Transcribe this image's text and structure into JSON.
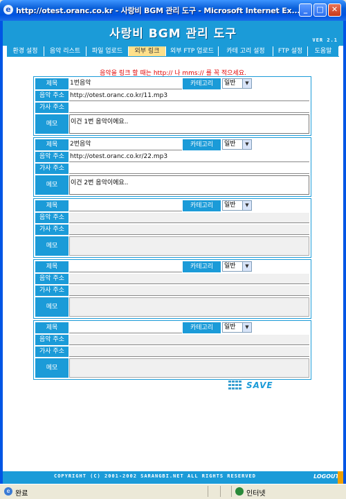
{
  "window": {
    "title": "http://otest.oranc.co.kr - 사랑비 BGM 관리 도구 - Microsoft Internet Ex...",
    "minimize": "_",
    "maximize": "□",
    "close": "✕"
  },
  "header": {
    "logo": "사랑비 BGM 관리 도구",
    "version": "VER 2.1"
  },
  "nav": [
    {
      "label": "환경 설정",
      "active": false
    },
    {
      "label": "음악 리스트",
      "active": false
    },
    {
      "label": "파일 업로드",
      "active": false
    },
    {
      "label": "외부 링크",
      "active": true
    },
    {
      "label": "외부 FTP 업로드",
      "active": false
    },
    {
      "label": "카테 고리 설정",
      "active": false
    },
    {
      "label": "FTP 설정",
      "active": false
    },
    {
      "label": "도움말",
      "active": false
    }
  ],
  "notice": "음악을 링크 할 때는 http:// 나 mms:// 를 꼭 적으세요.",
  "labels": {
    "title": "제목",
    "music_url": "음악 주소",
    "lyrics_url": "가사 주소",
    "memo": "메모",
    "category": "카테고리"
  },
  "entries": [
    {
      "title": "1번음악",
      "category": "일반",
      "music_url": "http://otest.oranc.co.kr/11.mp3",
      "lyrics_url": "",
      "memo": "이건 1번 음악이에요.."
    },
    {
      "title": "2번음악",
      "category": "일반",
      "music_url": "http://otest.oranc.co.kr/22.mp3",
      "lyrics_url": "",
      "memo": "이건 2번 음악이에요.."
    },
    {
      "title": "",
      "category": "일반",
      "music_url": "",
      "lyrics_url": "",
      "memo": ""
    },
    {
      "title": "",
      "category": "일반",
      "music_url": "",
      "lyrics_url": "",
      "memo": ""
    },
    {
      "title": "",
      "category": "일반",
      "music_url": "",
      "lyrics_url": "",
      "memo": ""
    }
  ],
  "save_label": "SAVE",
  "footer": {
    "copyright": "COPYRIGHT (C) 2001-2002 SARANGBI.NET ALL RIGHTS RESERVED",
    "logout": "LOGOUT"
  },
  "statusbar": {
    "done": "완료",
    "zone": "인터넷"
  }
}
